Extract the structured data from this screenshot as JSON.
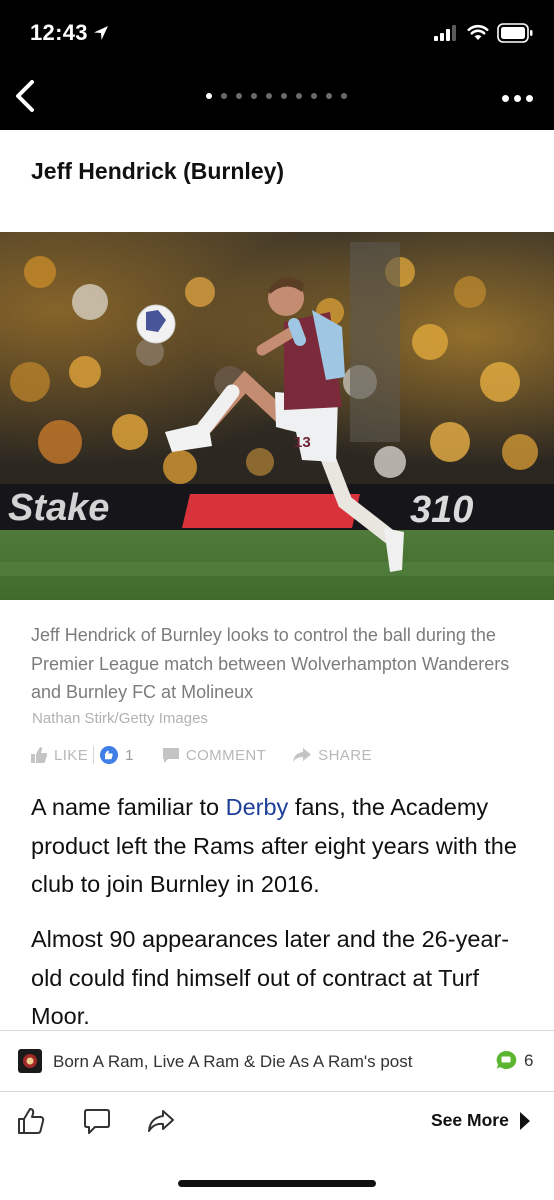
{
  "status_bar": {
    "time": "12:43"
  },
  "nav": {
    "page_count": 10,
    "active_page": 0
  },
  "article": {
    "headline": "Jeff Hendrick (Burnley)",
    "caption": "Jeff Hendrick of Burnley looks to control the ball during the Premier League match between Wolverhampton Wanderers and Burnley FC at Molineux",
    "credit": "Nathan Stirk/Getty Images",
    "shirt_number": "13",
    "body": {
      "p1_before": "A name familiar to ",
      "p1_link": "Derby",
      "p1_after": " fans, the Academy product left the Rams after eight years with the club to join Burnley in 2016.",
      "p2": "Almost 90 appearances later and the 26-year-old could find himself out of contract at Turf Moor."
    }
  },
  "actions": {
    "like_label": "LIKE",
    "like_count": "1",
    "comment_label": "COMMENT",
    "share_label": "SHARE"
  },
  "post": {
    "source_text": "Born A Ram, Live A Ram & Die As A Ram's post",
    "comment_count": "6"
  },
  "toolbar": {
    "see_more_label": "See More"
  },
  "colors": {
    "link": "#1d3f9a",
    "like_badge": "#3f7fe6",
    "comment_badge": "#5cb531",
    "claret": "#7a2a3a"
  },
  "icons": [
    "location-arrow-icon",
    "signal-icon",
    "wifi-icon",
    "battery-icon",
    "back-chevron-icon",
    "more-dots-icon",
    "thumbs-up-icon",
    "comment-icon",
    "share-arrow-icon",
    "play-triangle-icon"
  ]
}
